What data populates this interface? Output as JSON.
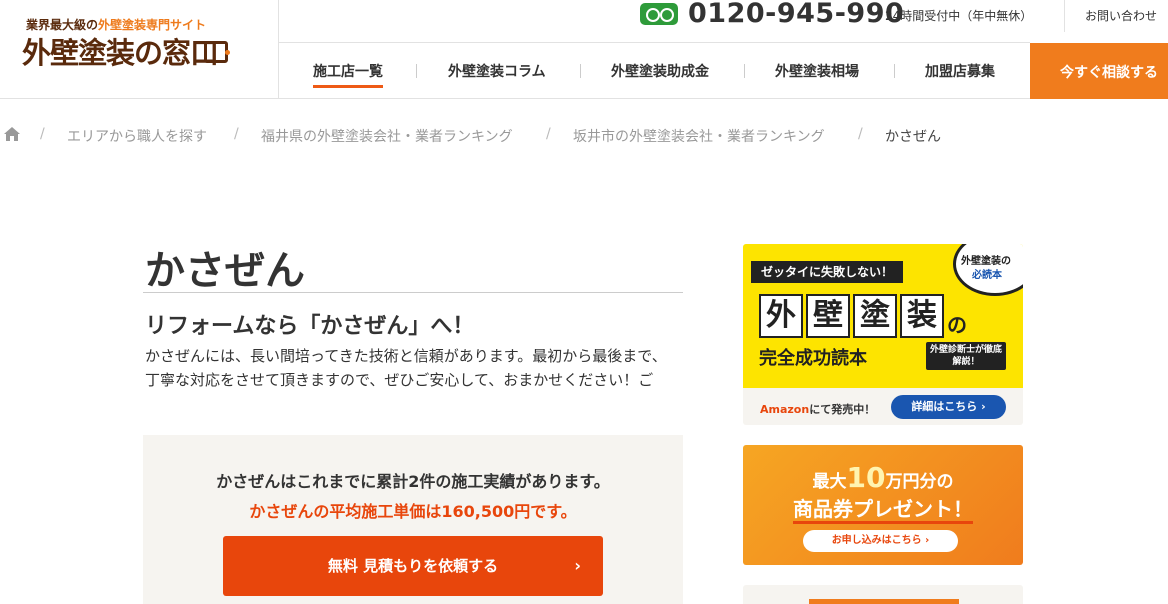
{
  "header": {
    "logo_tagline_prefix": "業界最大級の",
    "logo_tagline_highlight": "外壁塗装専門サイト",
    "logo_name": "外壁塗装の窓口",
    "phone": "0120-945-990",
    "phone_hours": "24時間受付中（年中無休）",
    "contact_link": "お問い合わせ",
    "nav": [
      {
        "label": "施工店一覧",
        "active": true
      },
      {
        "label": "外壁塗装コラム"
      },
      {
        "label": "外壁塗装助成金"
      },
      {
        "label": "外壁塗装相場"
      },
      {
        "label": "加盟店募集"
      }
    ],
    "cta": "今すぐ相談する"
  },
  "breadcrumb": [
    "エリアから職人を探す",
    "福井県の外壁塗装会社・業者ランキング",
    "坂井市の外壁塗装会社・業者ランキング",
    "かさぜん"
  ],
  "main": {
    "title": "かさぜん",
    "subtitle": "リフォームなら「かさぜん」へ！",
    "intro": "かさぜんには、長い間培ってきた技術と信頼があります。最初から最後まで、丁寧な対応をさせて頂きますので、ぜひご安心して、おまかせください！ご",
    "record_line1": "かさぜんはこれまでに累計2件の施工実績があります。",
    "record_line2": "かさぜんの平均施工単価は160,500円です。",
    "estimate_button": "無料 見積もりを依頼する",
    "estimate_chevron": "›"
  },
  "sidebar": {
    "book": {
      "tagline": "ゼッタイに失敗しない！",
      "circle_line1": "外壁塗装の",
      "circle_line2": "必読本",
      "title_chars": [
        "外",
        "壁",
        "塗",
        "装"
      ],
      "title_no": "の",
      "subtitle": "完全成功読本",
      "badge": "外壁診断士が徹底解説！",
      "amazon_brand": "Amazon",
      "amazon_text": "にて発売中！",
      "detail_button": "詳細はこちら ›"
    },
    "gift": {
      "line1_prefix": "最大",
      "line1_big": "10",
      "line1_suffix": "万円分の",
      "line2": "商品券プレゼント！",
      "button": "お申し込みはこちら ›"
    }
  },
  "colors": {
    "brand_orange": "#f07c1d",
    "accent_red": "#e8460c",
    "logo_brown": "#5a2a0c",
    "freedial_green": "#2e9b3a",
    "book_yellow": "#fde400",
    "link_blue": "#1a56b0"
  }
}
